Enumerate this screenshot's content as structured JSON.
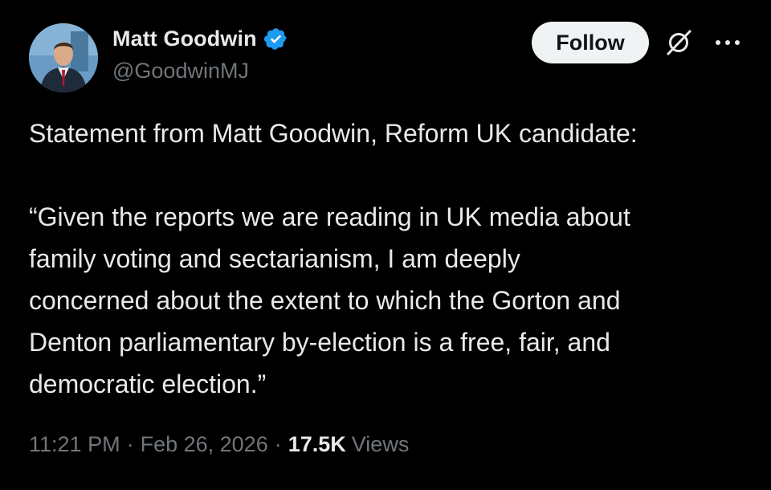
{
  "author": {
    "display_name": "Matt Goodwin",
    "handle": "@GoodwinMJ",
    "verified": true,
    "verified_color": "#1d9bf0",
    "avatar_icon": "profile-photo"
  },
  "actions": {
    "follow_label": "Follow",
    "grok_icon": "grok-icon",
    "more_icon": "more-icon"
  },
  "tweet": {
    "paragraphs": [
      "Statement from Matt Goodwin, Reform UK candidate:",
      "“Given the reports we are reading in UK media about\nfamily voting and sectarianism, I am deeply\nconcerned about the extent to which the Gorton and\nDenton parliamentary by-election is a free, fair, and\ndemocratic election.”"
    ]
  },
  "meta": {
    "time": "11:21 PM",
    "separator": "·",
    "date": "Feb 26, 2026",
    "views_count": "17.5K",
    "views_label": "Views"
  },
  "colors": {
    "background": "#000000",
    "text_primary": "#e7e9ea",
    "text_secondary": "#71767b",
    "button_bg": "#eff3f4"
  }
}
